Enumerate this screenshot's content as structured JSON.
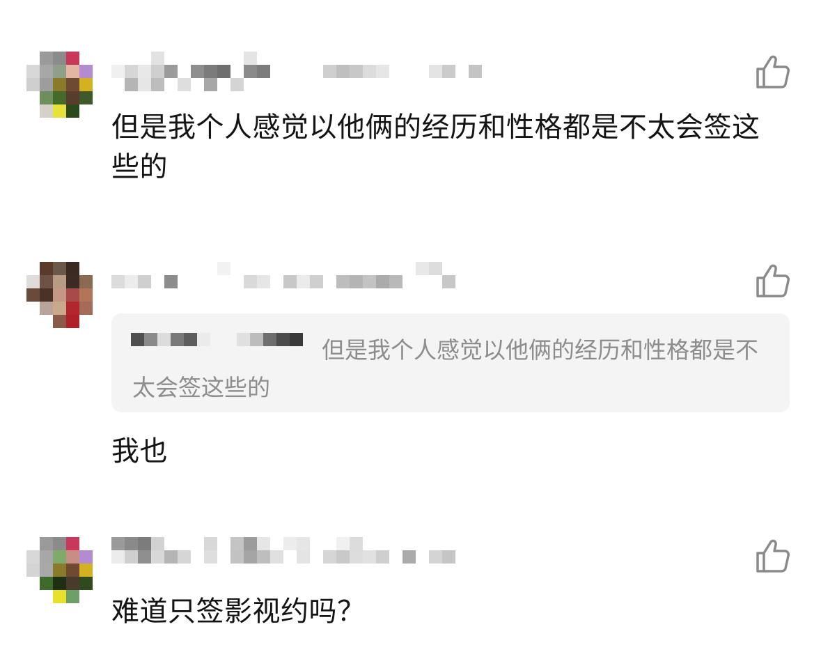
{
  "comments": [
    {
      "text": "但是我个人感觉以他俩的经历和性格都是不太会签这些的",
      "like_icon": "thumbs-up-icon"
    },
    {
      "quote_text": "但是我个人感觉以他俩的经历和性格都是不太会签这些的",
      "text": "我也",
      "like_icon": "thumbs-up-icon"
    },
    {
      "text": "难道只签影视约吗？",
      "like_icon": "thumbs-up-icon"
    }
  ],
  "colors": {
    "text": "#141414",
    "quote_text": "#8d8d8d",
    "quote_bg": "#f4f4f4",
    "icon": "#8a8a8a"
  }
}
